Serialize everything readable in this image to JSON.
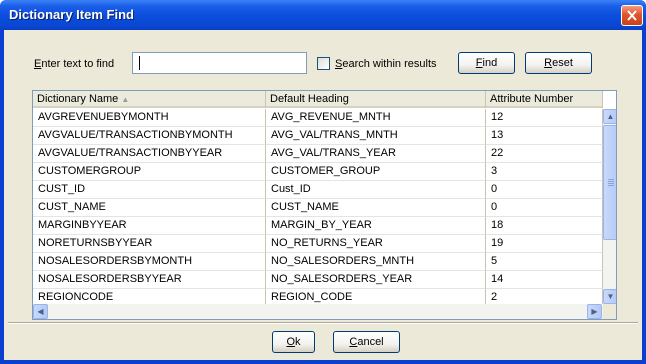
{
  "window": {
    "title": "Dictionary Item Find"
  },
  "search": {
    "label_first": "E",
    "label_rest": "nter text to find",
    "value": "",
    "checkbox_label_first": "S",
    "checkbox_label_rest": "earch within results",
    "checkbox_checked": false,
    "find_first": "F",
    "find_rest": "ind",
    "reset_first": "R",
    "reset_rest": "eset"
  },
  "table": {
    "columns": [
      "Dictionary Name",
      "Default Heading",
      "Attribute Number"
    ],
    "sort_indicator": "▲",
    "rows": [
      [
        "AVGREVENUEBYMONTH",
        "AVG_REVENUE_MNTH",
        "12"
      ],
      [
        "AVGVALUE/TRANSACTIONBYMONTH",
        "AVG_VAL/TRANS_MNTH",
        "13"
      ],
      [
        "AVGVALUE/TRANSACTIONBYYEAR",
        "AVG_VAL/TRANS_YEAR",
        "22"
      ],
      [
        "CUSTOMERGROUP",
        "CUSTOMER_GROUP",
        "3"
      ],
      [
        "CUST_ID",
        "Cust_ID",
        "0"
      ],
      [
        "CUST_NAME",
        "CUST_NAME",
        "0"
      ],
      [
        "MARGINBYYEAR",
        "MARGIN_BY_YEAR",
        "18"
      ],
      [
        "NORETURNSBYYEAR",
        "NO_RETURNS_YEAR",
        "19"
      ],
      [
        "NOSALESORDERSBYMONTH",
        "NO_SALESORDERS_MNTH",
        "5"
      ],
      [
        "NOSALESORDERSBYYEAR",
        "NO_SALESORDERS_YEAR",
        "14"
      ],
      [
        "REGIONCODE",
        "REGION_CODE",
        "2"
      ]
    ]
  },
  "footer": {
    "ok_first": "O",
    "ok_rest": "k",
    "cancel_first": "C",
    "cancel_rest": "ancel"
  },
  "colors": {
    "titlebar": "#0a47d3",
    "dialog_bg": "#ece9d8",
    "close": "#e1552e"
  },
  "icons": {
    "close": "close-icon",
    "scroll_up": "arrow-up-icon",
    "scroll_down": "arrow-down-icon",
    "scroll_left": "arrow-left-icon",
    "scroll_right": "arrow-right-icon"
  }
}
